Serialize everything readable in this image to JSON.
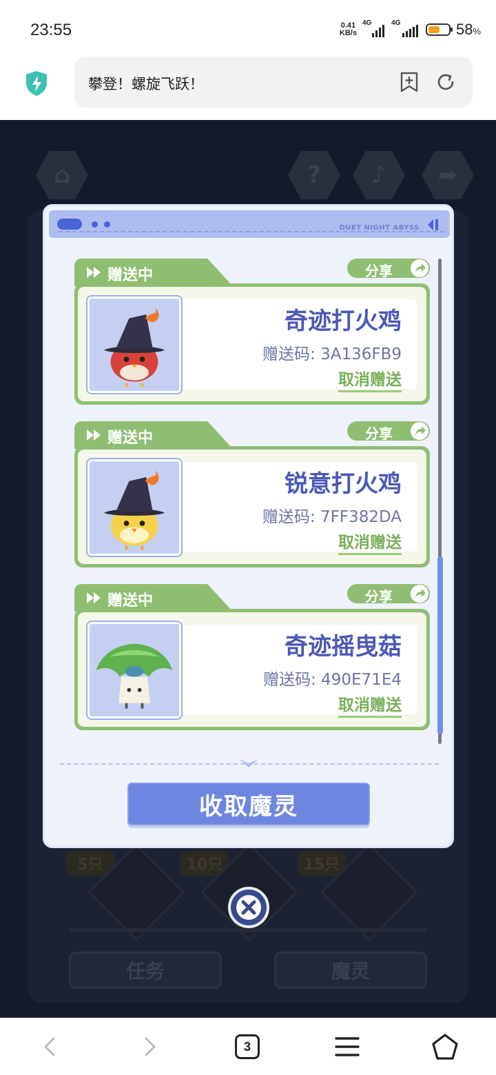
{
  "status_bar": {
    "time": "23:55",
    "net_speed_value": "0.41",
    "net_speed_unit": "KB/s",
    "sim1_label": "4G",
    "sim2_label": "4G",
    "battery_percent": "58",
    "battery_unit": "%",
    "battery_level": 0.58
  },
  "browser": {
    "url_title": "攀登！螺旋飞跃！",
    "shield_icon": "shield-bolt-icon",
    "bookmark_icon": "add-bookmark-icon",
    "reload_icon": "reload-icon"
  },
  "modal": {
    "brand": "DUET NIGHT ABYSS",
    "cards": [
      {
        "status": "赠送中",
        "share_label": "分享",
        "name": "奇迹打火鸡",
        "code": "赠送码: 3A136FB9",
        "cancel_label": "取消赠送",
        "portrait_icon": "red-chick-witch-hat"
      },
      {
        "status": "赠送中",
        "share_label": "分享",
        "name": "锐意打火鸡",
        "code": "赠送码: 7FF382DA",
        "cancel_label": "取消赠送",
        "portrait_icon": "yellow-chick-witch-hat"
      },
      {
        "status": "赠送中",
        "share_label": "分享",
        "name": "奇迹摇曳菇",
        "code": "赠送码: 490E71E4",
        "cancel_label": "取消赠送",
        "portrait_icon": "green-mushroom"
      }
    ],
    "collect_label": "收取魔灵"
  },
  "background": {
    "badges": [
      "5只",
      "10只",
      "15只"
    ],
    "tabs": [
      "任务",
      "魔灵"
    ]
  },
  "bottom_nav": {
    "tab_count": "3"
  },
  "colors": {
    "accent_blue": "#6f86e0",
    "accent_green": "#8fbe73",
    "name_text": "#4a58b8"
  }
}
